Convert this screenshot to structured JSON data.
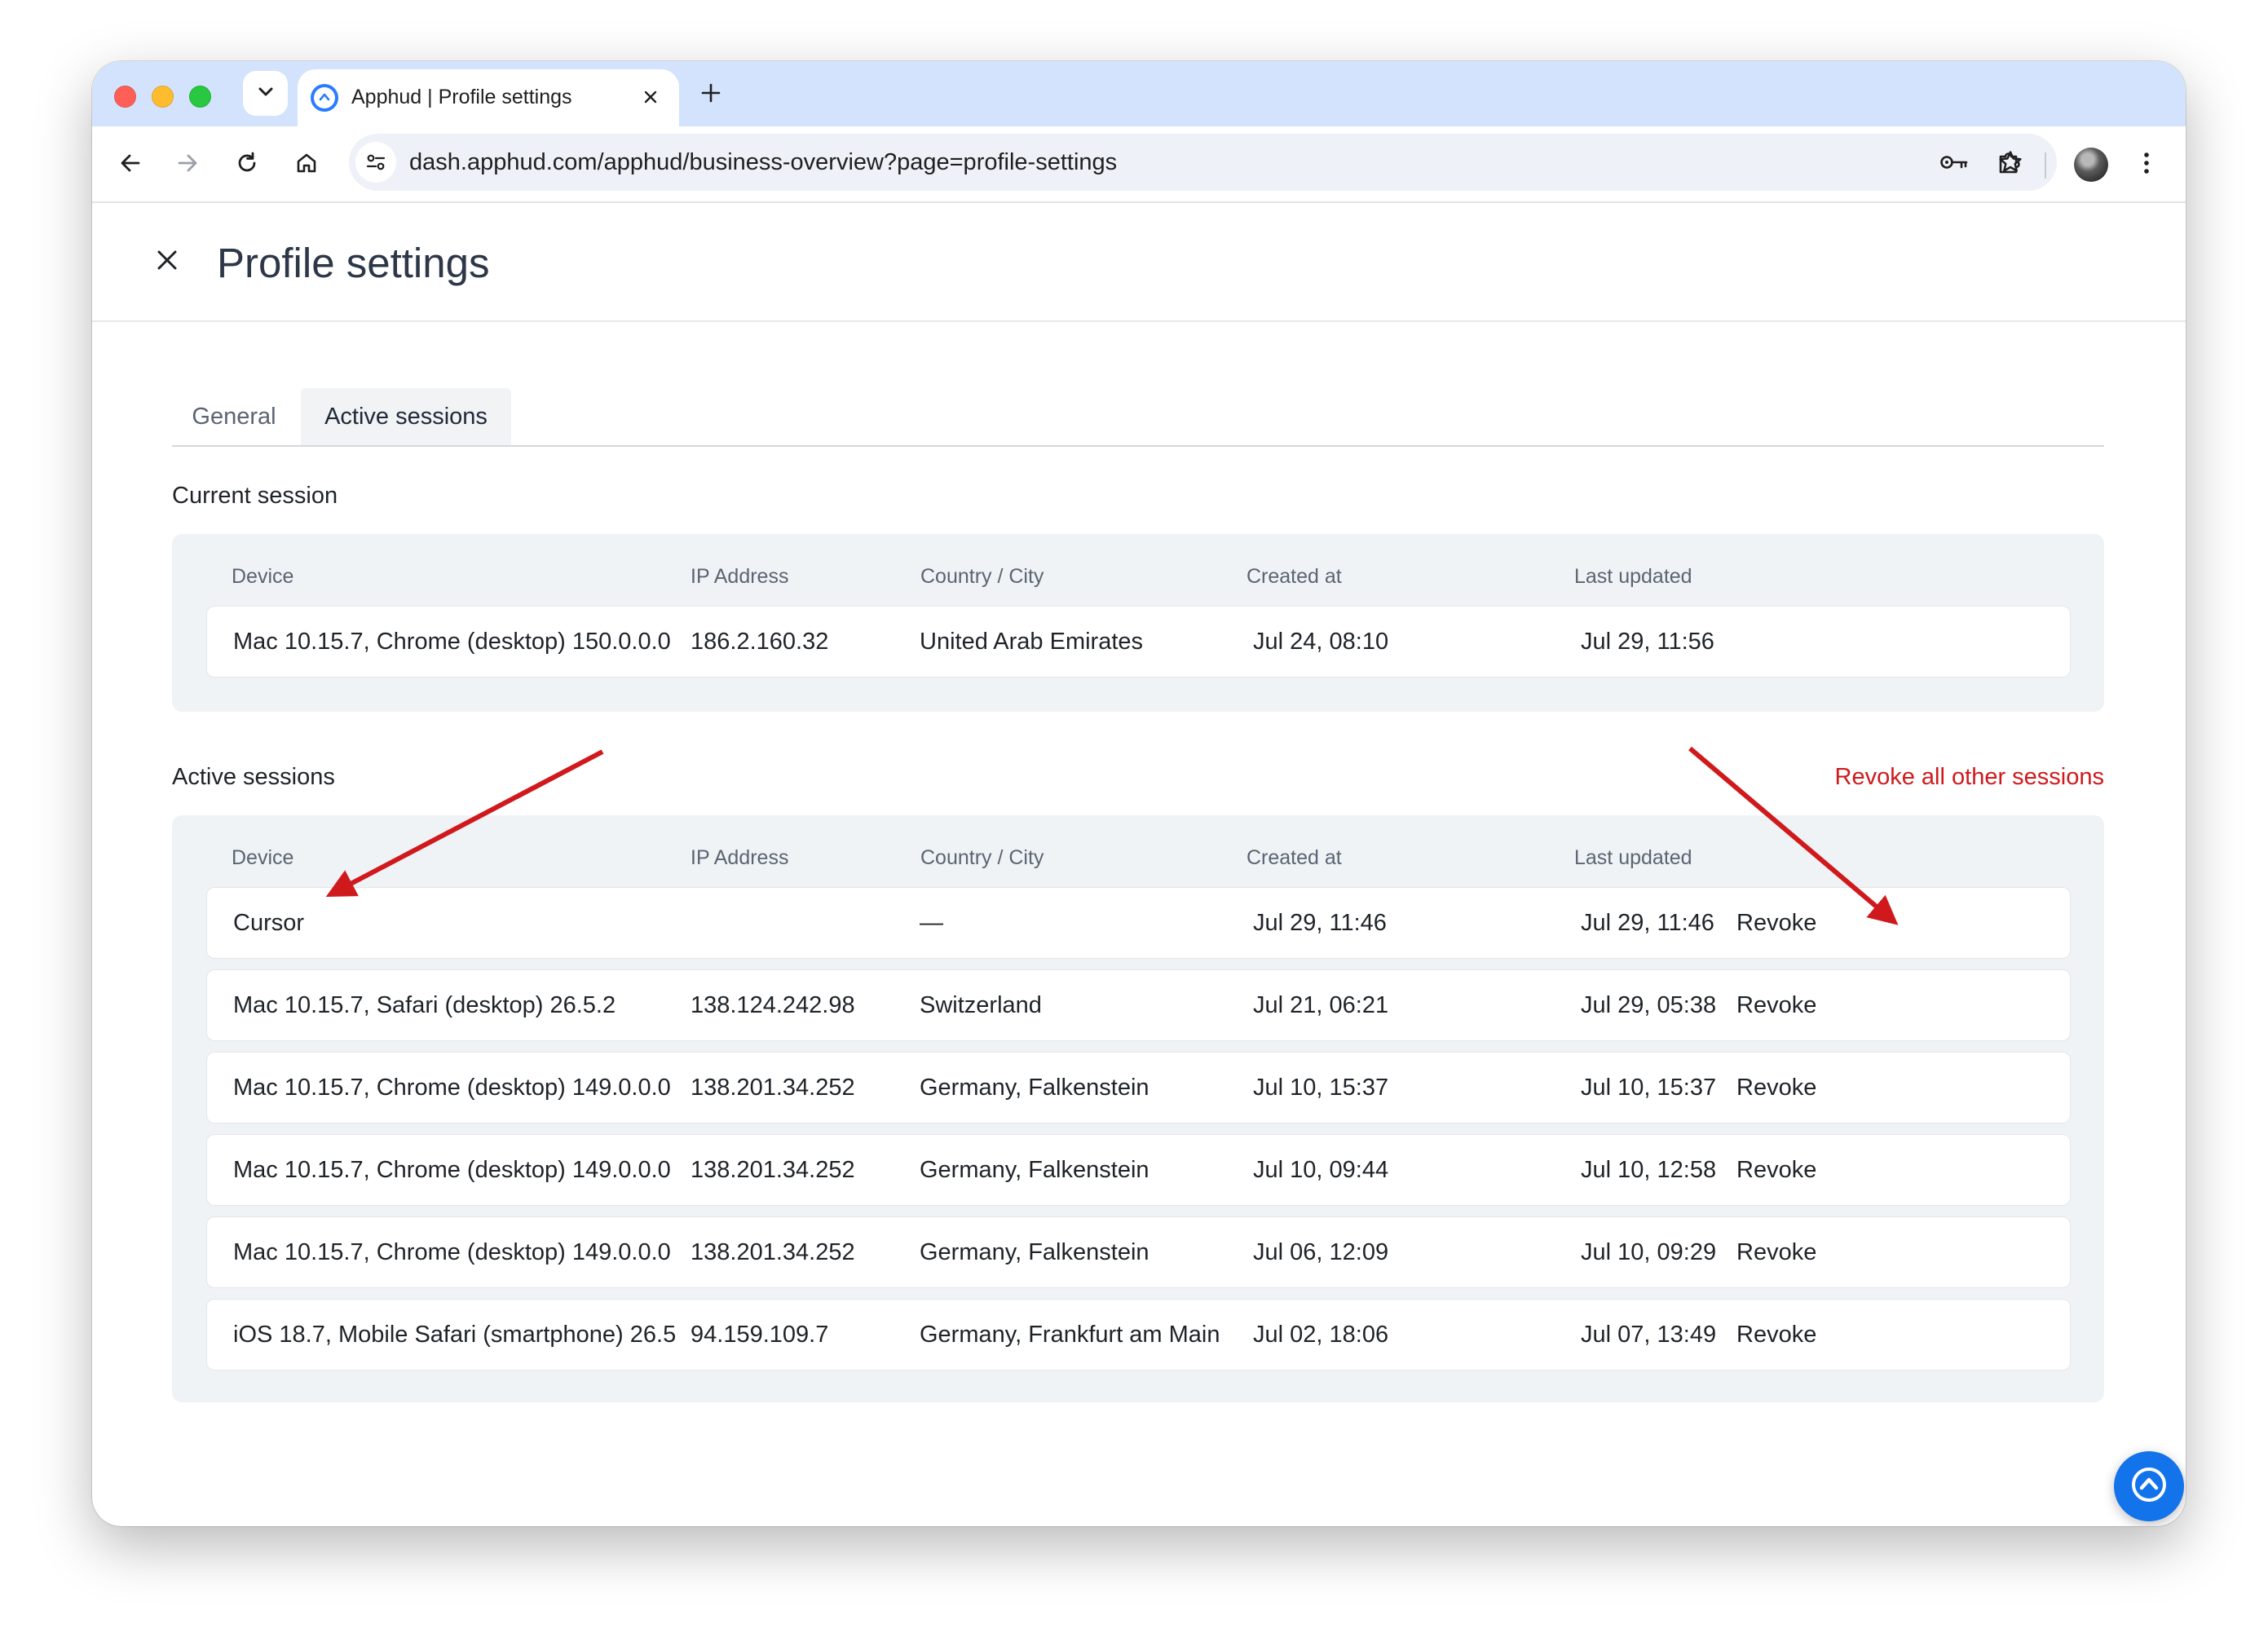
{
  "browser": {
    "tab_title": "Apphud | Profile settings",
    "url": "dash.apphud.com/apphud/business-overview?page=profile-settings"
  },
  "page": {
    "title": "Profile settings",
    "tabs": [
      "General",
      "Active sessions"
    ],
    "selected_tab": "Active sessions"
  },
  "columns": {
    "device": "Device",
    "ip": "IP Address",
    "location": "Country / City",
    "created": "Created at",
    "updated": "Last updated"
  },
  "current_session": {
    "title": "Current session",
    "rows": [
      {
        "device": "Mac 10.15.7, Chrome (desktop) 150.0.0.0",
        "ip": "186.2.160.32",
        "location": "United Arab Emirates",
        "created": "Jul 24, 08:10",
        "updated": "Jul 29, 11:56"
      }
    ]
  },
  "active_sessions": {
    "title": "Active sessions",
    "revoke_all_label": "Revoke all other sessions",
    "revoke_label": "Revoke",
    "rows": [
      {
        "device": "Cursor",
        "ip": "",
        "location": "—",
        "created": "Jul 29, 11:46",
        "updated": "Jul 29, 11:46"
      },
      {
        "device": "Mac 10.15.7, Safari (desktop) 26.5.2",
        "ip": "138.124.242.98",
        "location": "Switzerland",
        "created": "Jul 21, 06:21",
        "updated": "Jul 29, 05:38"
      },
      {
        "device": "Mac 10.15.7, Chrome (desktop) 149.0.0.0",
        "ip": "138.201.34.252",
        "location": "Germany, Falkenstein",
        "created": "Jul 10, 15:37",
        "updated": "Jul 10, 15:37"
      },
      {
        "device": "Mac 10.15.7, Chrome (desktop) 149.0.0.0",
        "ip": "138.201.34.252",
        "location": "Germany, Falkenstein",
        "created": "Jul 10, 09:44",
        "updated": "Jul 10, 12:58"
      },
      {
        "device": "Mac 10.15.7, Chrome (desktop) 149.0.0.0",
        "ip": "138.201.34.252",
        "location": "Germany, Falkenstein",
        "created": "Jul 06, 12:09",
        "updated": "Jul 10, 09:29"
      },
      {
        "device": "iOS 18.7, Mobile Safari (smartphone) 26.5",
        "ip": "94.159.109.7",
        "location": "Germany, Frankfurt am Main",
        "created": "Jul 02, 18:06",
        "updated": "Jul 07, 13:49"
      }
    ]
  },
  "icons": {
    "window_controls": [
      "close-dot",
      "minimize-dot",
      "zoom-dot"
    ],
    "toolbar": [
      "back-icon",
      "forward-icon",
      "reload-icon",
      "home-icon",
      "site-info-icon",
      "password-key-icon",
      "bookmark-star-icon",
      "extensions-icon",
      "profile-avatar",
      "menu-icon"
    ],
    "page": [
      "close-icon",
      "chat-support-icon"
    ]
  },
  "colors": {
    "accent_red": "#d0191c",
    "annotation_arrow": "#d0191c",
    "brand_blue": "#1273eb",
    "tabstrip": "#d3e3fd"
  }
}
